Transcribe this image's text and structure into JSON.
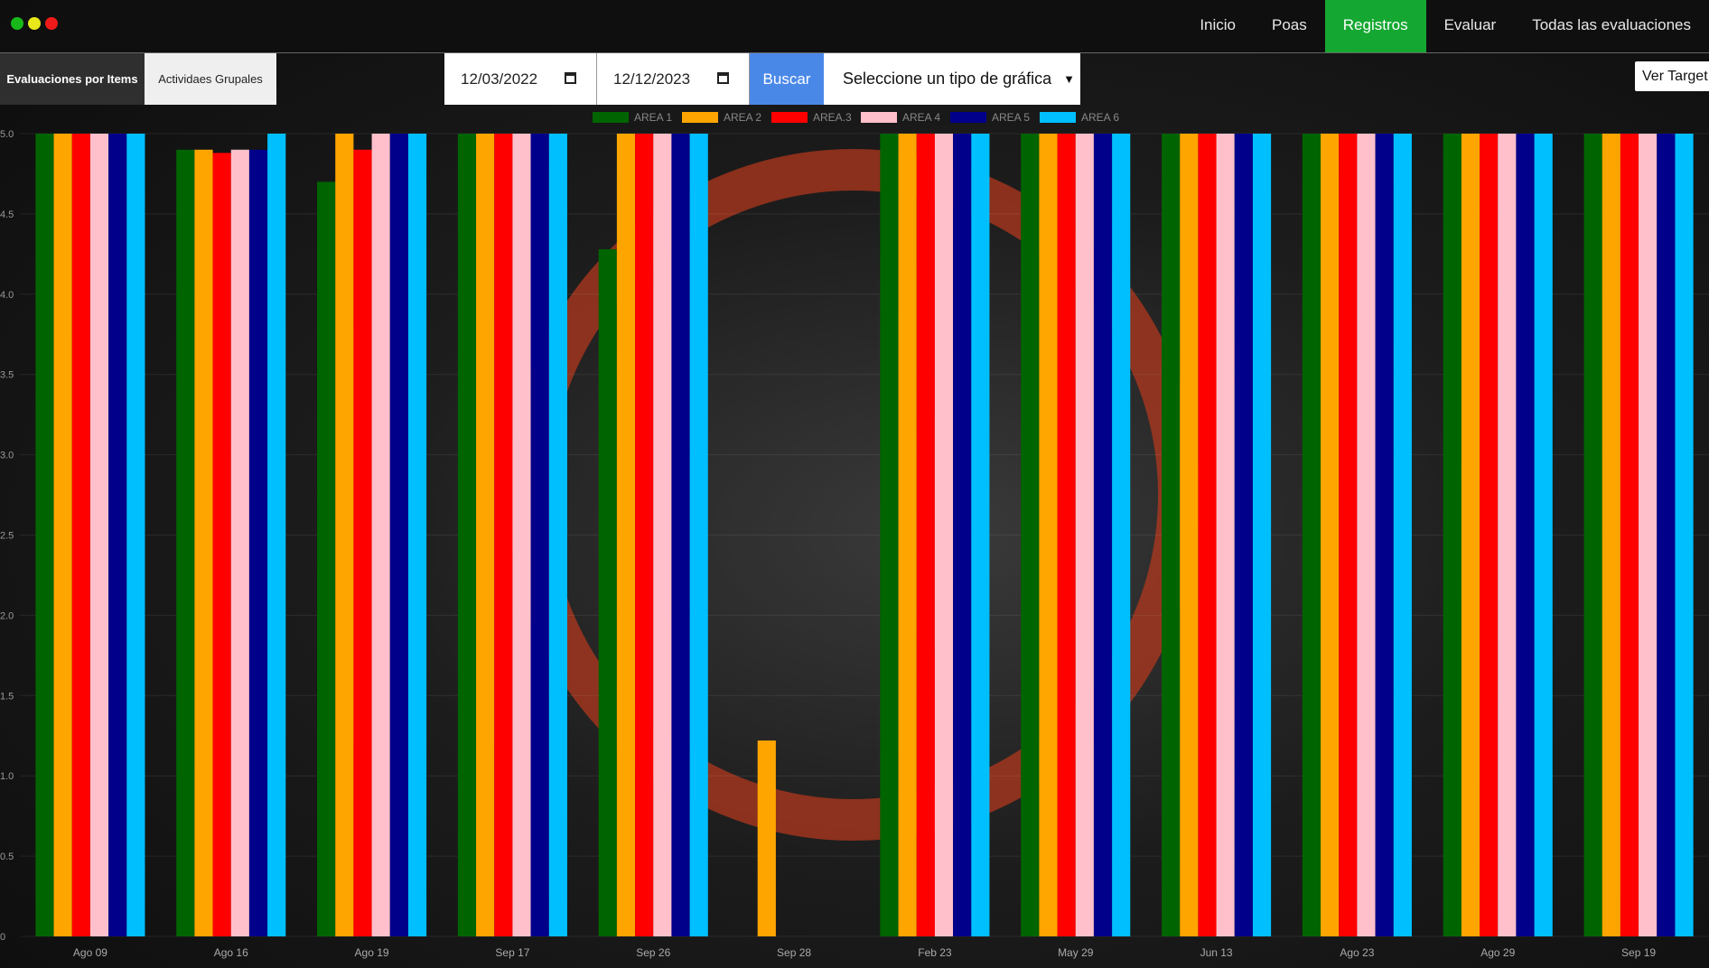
{
  "window": {
    "controls": [
      "#18b81a",
      "#e8e81a",
      "#f01a1a"
    ]
  },
  "nav": {
    "items": [
      "Inicio",
      "Poas",
      "Registros",
      "Evaluar",
      "Todas las evaluaciones"
    ],
    "active": "Registros",
    "active_color": "#14a832"
  },
  "toolbar": {
    "tab_items": "Evaluaciones por Items",
    "tab_group": "Actividaes Grupales",
    "date_from": "12/03/2022",
    "date_to": "12/12/2023",
    "search_label": "Buscar",
    "chart_type_selected": "Seleccione un tipo de gráfica",
    "target_label": "Ver Target"
  },
  "chart_data": {
    "type": "bar",
    "categories": [
      "Ago 09",
      "Ago 16",
      "Ago 19",
      "Sep 17",
      "Sep 26",
      "Sep 28",
      "Feb 23",
      "May 29",
      "Jun 13",
      "Ago 23",
      "Ago 29",
      "Sep 19"
    ],
    "series": [
      {
        "name": "AREA 1",
        "color": "#006400",
        "values": [
          5,
          4.9,
          4.7,
          5,
          4.28,
          null,
          5,
          5,
          5,
          5,
          5,
          5
        ]
      },
      {
        "name": "AREA 2",
        "color": "#ffa500",
        "values": [
          5,
          4.9,
          5,
          5,
          5,
          1.22,
          5,
          5,
          5,
          5,
          5,
          5
        ]
      },
      {
        "name": "AREA.3",
        "color": "#ff0000",
        "values": [
          5,
          4.88,
          4.9,
          5,
          5,
          null,
          5,
          5,
          5,
          5,
          5,
          5
        ]
      },
      {
        "name": "AREA 4",
        "color": "#ffc0cb",
        "values": [
          5,
          4.9,
          5,
          5,
          5,
          null,
          5,
          5,
          5,
          5,
          5,
          5
        ]
      },
      {
        "name": "AREA 5",
        "color": "#00008b",
        "values": [
          5,
          4.9,
          5,
          5,
          5,
          null,
          5,
          5,
          5,
          5,
          5,
          5
        ]
      },
      {
        "name": "AREA 6",
        "color": "#00bfff",
        "values": [
          5,
          5,
          5,
          5,
          5,
          null,
          5,
          5,
          5,
          5,
          5,
          5
        ]
      }
    ],
    "y_ticks": [
      "0",
      "0.5",
      "1.0",
      "1.5",
      "2.0",
      "2.5",
      "3.0",
      "3.5",
      "4.0",
      "4.5",
      "5.0"
    ],
    "ylim": [
      0,
      5
    ],
    "legend": "top-center",
    "grid": true
  }
}
